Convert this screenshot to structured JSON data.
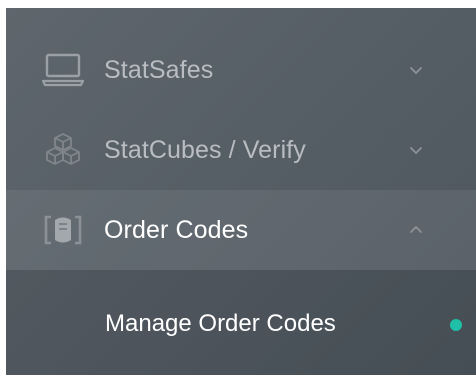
{
  "sidebar": {
    "items": [
      {
        "label": "StatSafes",
        "icon": "laptop-icon",
        "expanded": false
      },
      {
        "label": "StatCubes / Verify",
        "icon": "cubes-icon",
        "expanded": false
      },
      {
        "label": "Order Codes",
        "icon": "order-codes-icon",
        "expanded": true
      }
    ],
    "submenu": [
      {
        "label": "Manage Order Codes",
        "active": true
      }
    ]
  },
  "colors": {
    "active_dot": "#1fbfa8",
    "inactive_text": "#b9bdc1",
    "active_text": "#ffffff"
  }
}
